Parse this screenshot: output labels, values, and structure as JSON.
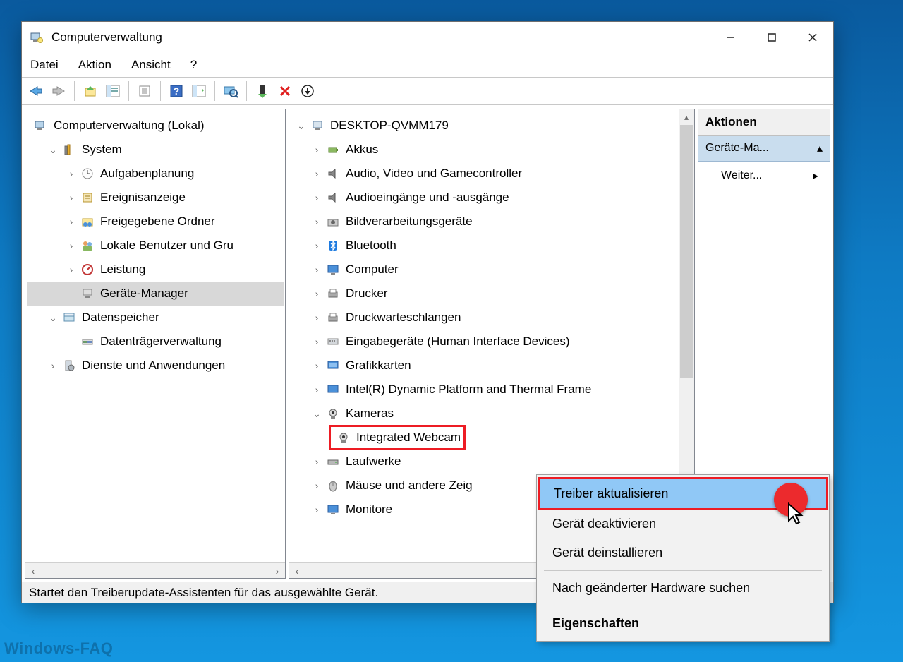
{
  "window": {
    "title": "Computerverwaltung"
  },
  "menu": {
    "file": "Datei",
    "action": "Aktion",
    "view": "Ansicht",
    "help": "?"
  },
  "status": "Startet den Treiberupdate-Assistenten für das ausgewählte Gerät.",
  "watermark": "Windows-FAQ",
  "left_tree": {
    "root": "Computerverwaltung (Lokal)",
    "system": "System",
    "system_children": [
      "Aufgabenplanung",
      "Ereignisanzeige",
      "Freigegebene Ordner",
      "Lokale Benutzer und Gru",
      "Leistung",
      "Geräte-Manager"
    ],
    "storage": "Datenspeicher",
    "storage_children": [
      "Datenträgerverwaltung"
    ],
    "services": "Dienste und Anwendungen"
  },
  "center_tree": {
    "root": "DESKTOP-QVMM179",
    "items": [
      "Akkus",
      "Audio, Video und Gamecontroller",
      "Audioeingänge und -ausgänge",
      "Bildverarbeitungsgeräte",
      "Bluetooth",
      "Computer",
      "Drucker",
      "Druckwarteschlangen",
      "Eingabegeräte (Human Interface Devices)",
      "Grafikkarten",
      "Intel(R) Dynamic Platform and Thermal Frame"
    ],
    "cameras": "Kameras",
    "camera_child": "Integrated Webcam",
    "after": [
      "Laufwerke",
      "Mäuse und andere Zeig",
      "Monitore"
    ]
  },
  "actions": {
    "header": "Aktionen",
    "sub": "Geräte-Ma...",
    "item": "Weiter..."
  },
  "context": {
    "update": "Treiber aktualisieren",
    "disable": "Gerät deaktivieren",
    "uninstall": "Gerät deinstallieren",
    "scan": "Nach geänderter Hardware suchen",
    "props": "Eigenschaften"
  }
}
